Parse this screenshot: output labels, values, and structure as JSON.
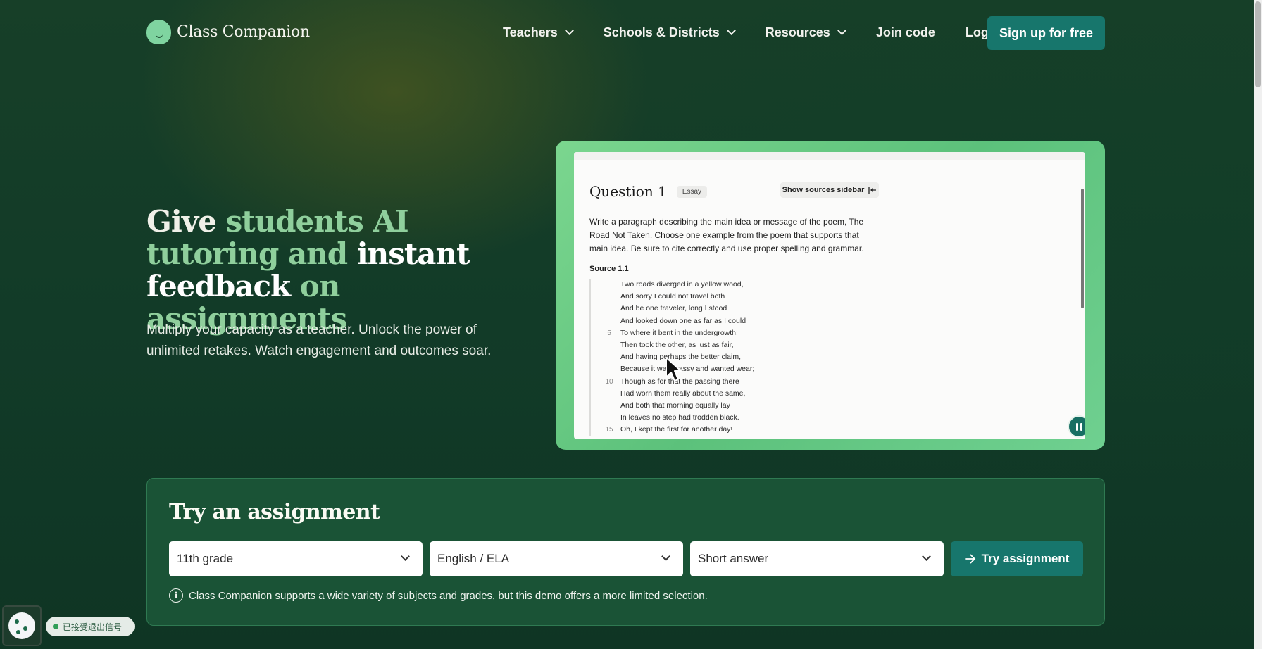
{
  "nav": {
    "brand": "Class Companion",
    "items": [
      {
        "label": "Teachers",
        "has_menu": true
      },
      {
        "label": "Schools & Districts",
        "has_menu": true
      },
      {
        "label": "Resources",
        "has_menu": true
      },
      {
        "label": "Join code",
        "has_menu": false
      },
      {
        "label": "Log in",
        "has_menu": false
      }
    ],
    "cta": "Sign up for free"
  },
  "hero": {
    "title_parts": [
      "Give",
      " students AI tutoring",
      " and",
      " instant feedback",
      " on",
      " assignments"
    ],
    "subtitle": "Multiply your capacity as a teacher. Unlock the power of unlimited retakes. Watch engagement and outcomes soar."
  },
  "preview": {
    "question_title": "Question 1",
    "badge": "Essay",
    "sources_button": "Show sources sidebar",
    "prompt": "Write a paragraph describing the main idea or message of the poem, The Road Not Taken. Choose one example from the poem that supports that main idea. Be sure to cite correctly and use proper spelling and grammar.",
    "source_label": "Source 1.1",
    "poem_lines": [
      {
        "num": "",
        "text": "Two roads diverged in a yellow wood,"
      },
      {
        "num": "",
        "text": "And sorry I could not travel both"
      },
      {
        "num": "",
        "text": "And be one traveler, long I stood"
      },
      {
        "num": "",
        "text": "And looked down one as far as I could"
      },
      {
        "num": "5",
        "text": "To where it bent in the undergrowth;"
      },
      {
        "num": "",
        "text": "Then took the other, as just as fair,"
      },
      {
        "num": "",
        "text": "And having perhaps the better claim,"
      },
      {
        "num": "",
        "text": "Because it was grassy and wanted wear;"
      },
      {
        "num": "10",
        "text": "Though as for that the passing there"
      },
      {
        "num": "",
        "text": "Had worn them really about the same,"
      },
      {
        "num": "",
        "text": "And both that morning equally lay"
      },
      {
        "num": "",
        "text": "In leaves no step had trodden black."
      },
      {
        "num": "15",
        "text": "Oh, I kept the first for another day!"
      }
    ]
  },
  "try": {
    "title": "Try an assignment",
    "grade": "11th grade",
    "subject": "English / ELA",
    "type": "Short answer",
    "button": "Try assignment",
    "note": "Class Companion supports a wide variety of subjects and grades, but this demo offers a more limited selection."
  },
  "toast": "已接受退出信号",
  "colors": {
    "accent": "#17766c",
    "hero_highlight": "#8fcf9c",
    "preview_frame": "#6fd090"
  },
  "icons": [
    "chevron-down-icon",
    "info-icon",
    "arrow-right-icon",
    "pause-icon",
    "cookie-icon",
    "sidebar-icon",
    "cursor-icon"
  ]
}
